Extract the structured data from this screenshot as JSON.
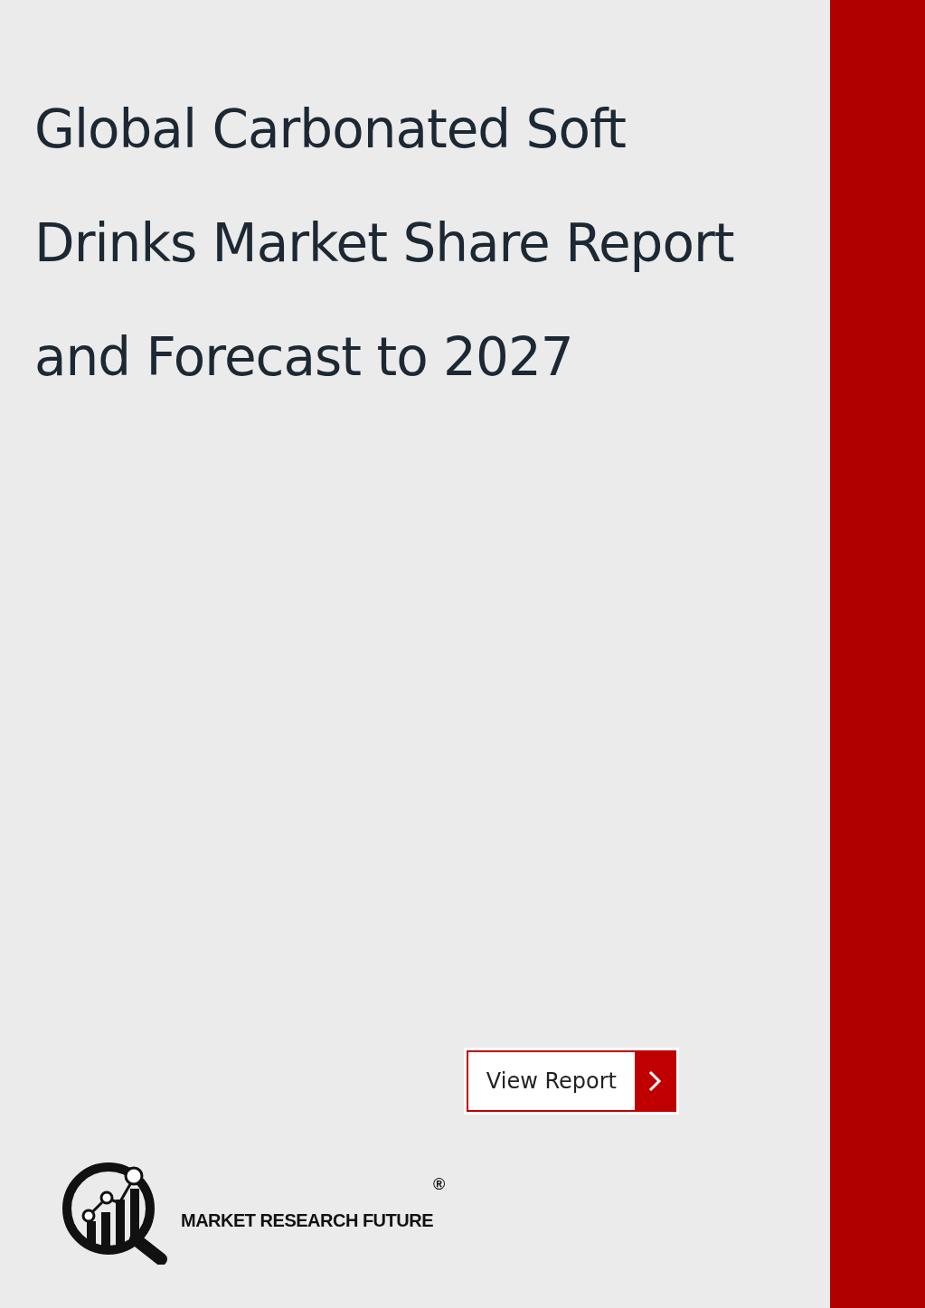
{
  "title": "Global Carbonated Soft Drinks Market Share Report and Forecast to 2027",
  "button": {
    "label": "View Report"
  },
  "logo": {
    "name": "MARKET RESEARCH FUTURE",
    "mark": "®"
  }
}
